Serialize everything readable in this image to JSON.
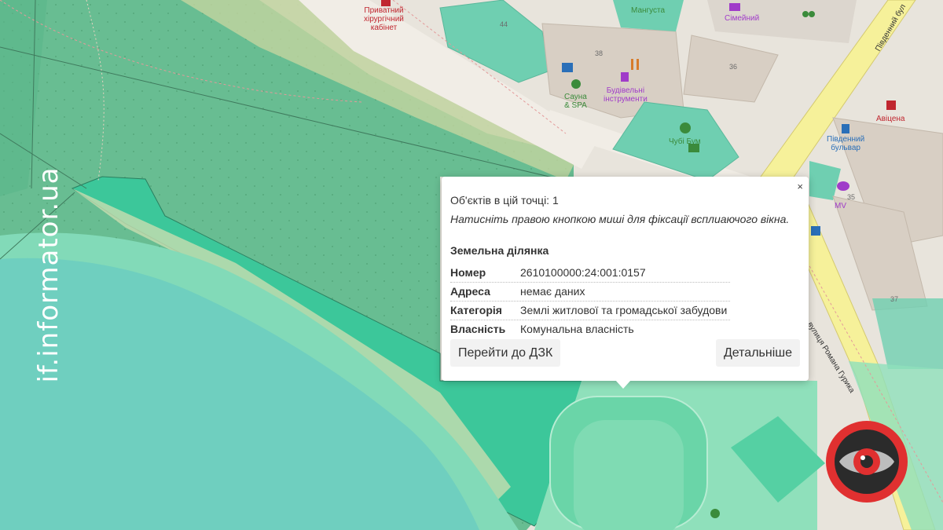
{
  "watermark": "if.informator.ua",
  "map_labels": {
    "private_clinic": [
      "Приватний",
      "хірургічний",
      "кабінет"
    ],
    "mangusta": "Мангуста",
    "simeinyi": "Сімейний",
    "road_pivdennyi": "Південний бул",
    "num_44": "44",
    "num_38": "38",
    "num_36": "36",
    "num_35": "35",
    "num_37": "37",
    "sauna": [
      "Сауна",
      "& SPA"
    ],
    "building_tools": [
      "Будівельні",
      "інструменти"
    ],
    "chubi_bum": "Чубі Бум",
    "avitsena": "Авіцена",
    "stop_pivdennyi": [
      "Південний",
      "бульвар"
    ],
    "mv": "MV",
    "road_huryka": "вулиця Романа Гурика"
  },
  "popup": {
    "close": "×",
    "objects": "Об'єктів в цій точці: 1",
    "hint": "Натисніть правою кнопкою миші для фіксації всплиаючого вікна.",
    "section_title": "Земельна ділянка",
    "rows": [
      {
        "key": "Номер",
        "value": "2610100000:24:001:0157"
      },
      {
        "key": "Адреса",
        "value": "немає даних"
      },
      {
        "key": "Категорія",
        "value": "Землі житлової та громадської забудови"
      },
      {
        "key": "Власність",
        "value": "Комунальна власність"
      }
    ],
    "btn_dzk": "Перейти до ДЗК",
    "btn_details": "Детальніше"
  },
  "colors": {
    "parcel_green": "#5cc49a",
    "highlight": "#3cc79a",
    "water": "#6fcfbf"
  }
}
